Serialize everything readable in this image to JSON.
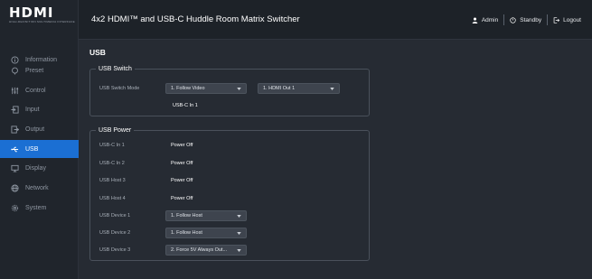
{
  "brand": {
    "logo": "HDMI",
    "tagline": "HIGH-DEFINITION MULTIMEDIA INTERFACE"
  },
  "header": {
    "title": "4x2 HDMI™ and USB-C Huddle Room Matrix Switcher",
    "admin_label": "Admin",
    "standby_label": "Standby",
    "logout_label": "Logout"
  },
  "sidebar": {
    "items": [
      {
        "label": "Information",
        "icon": "info-icon",
        "active": false
      },
      {
        "label": "Preset",
        "icon": "preset-icon",
        "active": false
      },
      {
        "label": "Control",
        "icon": "sliders-icon",
        "active": false
      },
      {
        "label": "Input",
        "icon": "input-icon",
        "active": false
      },
      {
        "label": "Output",
        "icon": "output-icon",
        "active": false
      },
      {
        "label": "USB",
        "icon": "usb-icon",
        "active": true
      },
      {
        "label": "Display",
        "icon": "monitor-icon",
        "active": false
      },
      {
        "label": "Network",
        "icon": "globe-icon",
        "active": false
      },
      {
        "label": "System",
        "icon": "gear-icon",
        "active": false
      }
    ]
  },
  "page": {
    "title": "USB"
  },
  "usb_switch": {
    "legend": "USB Switch",
    "mode_label": "USB Switch Mode",
    "mode_value": "1. Follow Video",
    "output_value": "1. HDMI Out 1",
    "status": "USB-C In 1"
  },
  "usb_power": {
    "legend": "USB Power",
    "ports": [
      {
        "label": "USB-C In 1",
        "value": "Power Off"
      },
      {
        "label": "USB-C In 2",
        "value": "Power Off"
      },
      {
        "label": "USB Host 3",
        "value": "Power Off"
      },
      {
        "label": "USB Host 4",
        "value": "Power Off"
      }
    ],
    "devices": [
      {
        "label": "USB Device 1",
        "value": "1. Follow Host"
      },
      {
        "label": "USB Device 2",
        "value": "1. Follow Host"
      },
      {
        "label": "USB Device 3",
        "value": "2. Force 5V Always Out..."
      }
    ]
  },
  "colors": {
    "accent": "#1b6fd3",
    "background": "#262b33",
    "sidebar": "#20252c",
    "topbar": "#1d2228"
  }
}
